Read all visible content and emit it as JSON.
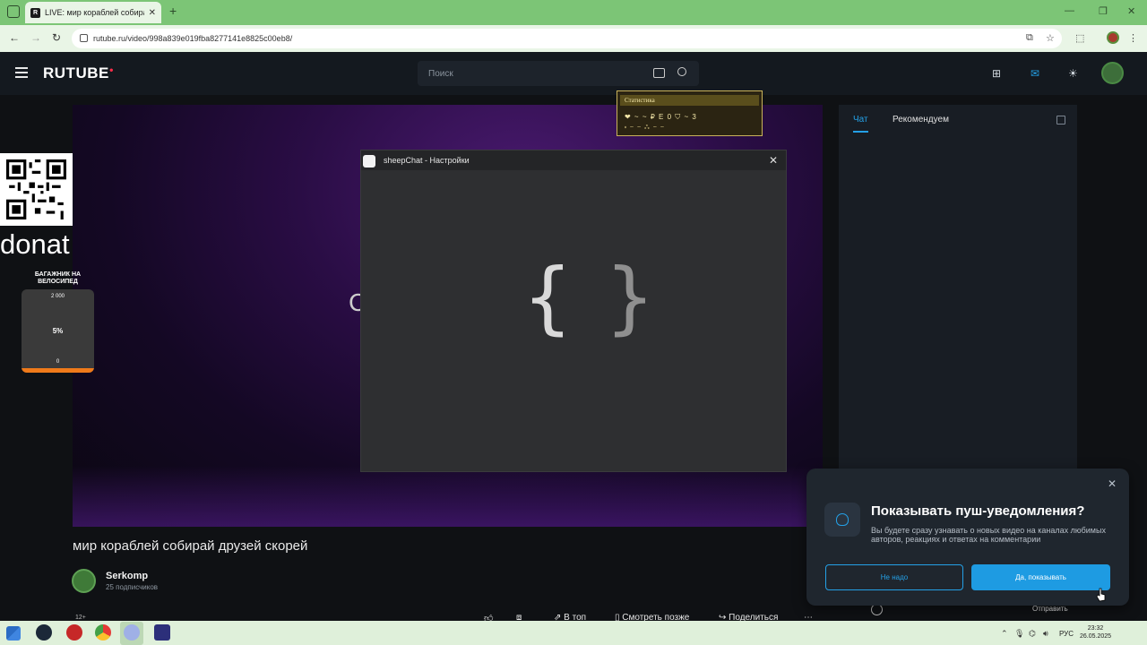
{
  "browser": {
    "tab_title": "LIVE: мир кораблей собирай д",
    "tab_favicon": "R",
    "new_tab": "+",
    "url": "rutube.ru/video/998a839e019fba8277141e8825c00eb8/",
    "window_controls": [
      "—",
      "❐",
      "✕"
    ]
  },
  "header": {
    "logo": "RUTUBE",
    "search_placeholder": "Поиск"
  },
  "stream_overlay": {
    "donat_label": "donat",
    "goal_title": "БАГАЖНИК НА ВЕЛОСИПЕД",
    "goal_max": "2 000",
    "goal_percent": "5%",
    "goal_min": "0",
    "goal_progress": 0.05,
    "partial_letter": "C"
  },
  "stats_widget": {
    "header": "Статистика",
    "line1": "❤ ~ ~ ₽ Е 0 ⛉ ~ 3",
    "line2": "⬪ ~ ~ ⁂ ~ ~"
  },
  "sheepchat": {
    "title": "sheepChat - Настройки",
    "placeholder_left": "{",
    "placeholder_right": "}"
  },
  "chat_panel": {
    "tab_chat": "Чат",
    "tab_recommend": "Рекомендуем"
  },
  "video": {
    "title": "мир кораблей собирай друзей скорей",
    "channel": "Serkomp",
    "subscribers": "25 подписчиков",
    "age_rating": "12+",
    "actions": {
      "to_top": "В топ",
      "watch_later": "Смотреть позже",
      "share": "Поделиться",
      "more": "⋯"
    },
    "send": "Отправить"
  },
  "push": {
    "heading": "Показывать пуш-уведомления?",
    "description": "Вы будете сразу узнавать о новых видео на каналах любимых авторов, реакциях и ответах на комментарии",
    "btn_no": "Не надо",
    "btn_yes": "Да, показывать"
  },
  "taskbar": {
    "lang": "РУС",
    "time": "23:32",
    "date": "26.05.2025"
  },
  "colors": {
    "accent": "#24a0e6",
    "browser_green": "#7cc576",
    "goal_fill": "#ef7a1a"
  }
}
